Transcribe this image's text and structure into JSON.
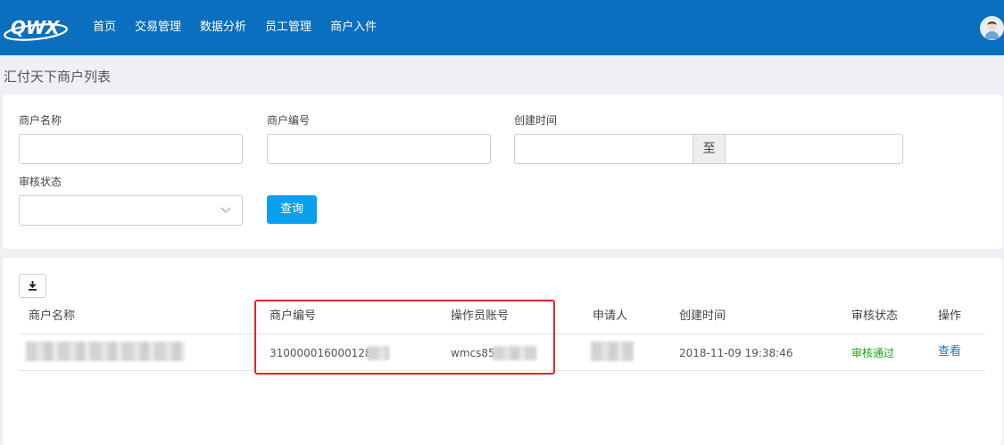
{
  "header": {
    "logo_text": "QWX",
    "nav": [
      "首页",
      "交易管理",
      "数据分析",
      "员工管理",
      "商户入件"
    ]
  },
  "page": {
    "title": "汇付天下商户列表"
  },
  "filters": {
    "merchant_name_label": "商户名称",
    "merchant_no_label": "商户编号",
    "created_time_label": "创建时间",
    "date_separator": "至",
    "audit_status_label": "审核状态",
    "query_button": "查询"
  },
  "table": {
    "columns": [
      "商户名称",
      "商户编号",
      "操作员账号",
      "申请人",
      "创建时间",
      "审核状态",
      "操作"
    ],
    "rows": [
      {
        "merchant_no": "310000016000128",
        "operator": "wmcs85",
        "created": "2018-11-09 19:38:46",
        "status": "审核通过",
        "action": "查看"
      }
    ]
  },
  "colors": {
    "topbar": "#0a6fbe",
    "primary_button": "#0aa0f0",
    "status_ok": "#19a01c",
    "link": "#1878c8",
    "highlight_box": "#e8242b"
  },
  "icons": {
    "download": "download-icon",
    "dropdown": "chevron-down-icon",
    "avatar": "user-avatar"
  }
}
